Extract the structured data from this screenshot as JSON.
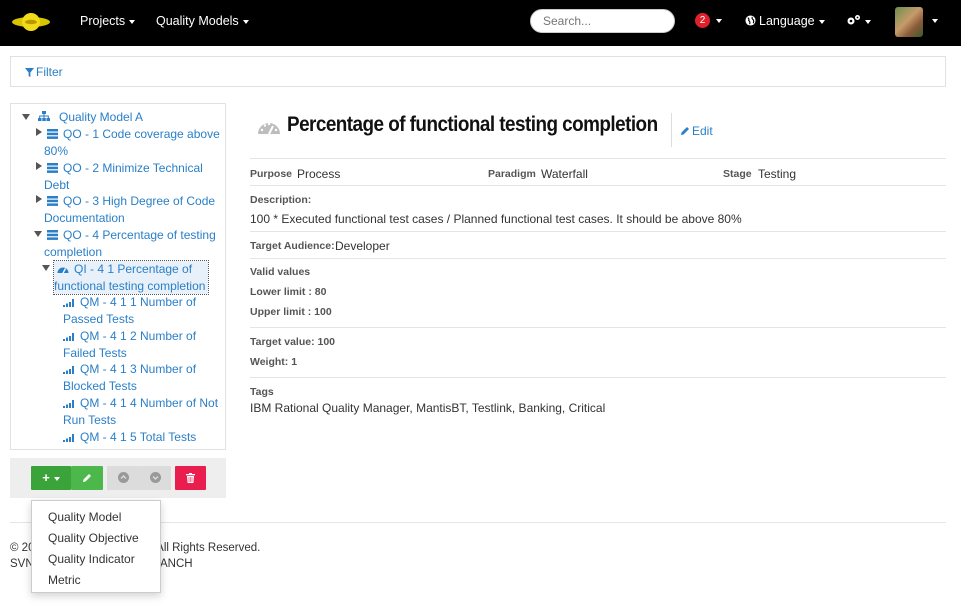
{
  "navbar": {
    "projects_label": "Projects",
    "quality_models_label": "Quality Models",
    "search_placeholder": "Search...",
    "notifications_count": "2",
    "language_label": "Language"
  },
  "filter": {
    "label": "Filter"
  },
  "tree": {
    "root": "Quality Model A",
    "qo1_line1": "QO - 1 Code coverage above",
    "qo1_line2": "80%",
    "qo2_line1": "QO - 2 Minimize Technical",
    "qo2_line2": "Debt",
    "qo3_line1": "QO - 3 High Degree of Code",
    "qo3_line2": "Documentation",
    "qo4_line1": "QO - 4 Percentage of testing",
    "qo4_line2": "completion",
    "qi_line1": "QI - 4 1 Percentage of",
    "qi_line2": "functional testing completion",
    "qm1_line1": "QM - 4 1 1 Number of",
    "qm1_line2": "Passed Tests",
    "qm2_line1": "QM - 4 1 2 Number of",
    "qm2_line2": "Failed Tests",
    "qm3_line1": "QM - 4 1 3 Number of",
    "qm3_line2": "Blocked Tests",
    "qm4_line1": "QM - 4 1 4 Number of Not",
    "qm4_line2": "Run Tests",
    "qm5_line1": "QM - 4 1 5 Total Tests"
  },
  "toolbar": {
    "add_label": "+"
  },
  "add_menu": {
    "items": [
      "Quality Model",
      "Quality Objective",
      "Quality Indicator",
      "Metric"
    ]
  },
  "footer": {
    "copyright_left": "© 20",
    "copyright_right": "n. All Rights Reserved.",
    "line2_left": "SVN",
    "line2_right": "ANCH"
  },
  "detail": {
    "title": "Percentage of functional testing completion",
    "edit_label": "Edit",
    "purpose_label": "Purpose",
    "purpose_value": "Process",
    "paradigm_label": "Paradigm",
    "paradigm_value": "Waterfall",
    "stage_label": "Stage",
    "stage_value": "Testing",
    "description_label": "Description:",
    "description_value": "100 * Executed functional test cases / Planned functional test cases. It should be above 80%",
    "audience_label": "Target Audience:",
    "audience_value": "Developer",
    "valid_values_label": "Valid values",
    "lower_limit": "Lower limit : 80",
    "upper_limit": "Upper limit : 100",
    "target_value": "Target value: 100",
    "weight": "Weight: 1",
    "tags_label": "Tags",
    "tags_value": "IBM Rational Quality Manager, MantisBT, Testlink, Banking, Critical"
  },
  "colors": {
    "navbar_bg": "#000000",
    "link": "#2a7fc7",
    "add_button": "#3aa33a",
    "delete_button": "#e91e4e",
    "badge": "#e0212c"
  }
}
